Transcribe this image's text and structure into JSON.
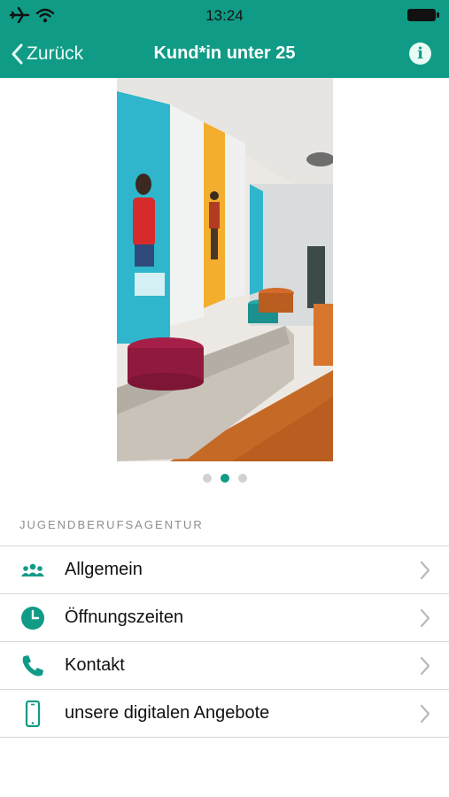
{
  "status_bar": {
    "time": "13:24"
  },
  "nav": {
    "back_label": "Zurück",
    "title": "Kund*in unter 25",
    "info_label": "i"
  },
  "carousel": {
    "page_count": 3,
    "active_index": 1
  },
  "section": {
    "header": "JUGENDBERUFSAGENTUR"
  },
  "menu": [
    {
      "label": "Allgemein",
      "icon": "people-icon"
    },
    {
      "label": "Öffnungszeiten",
      "icon": "clock-icon"
    },
    {
      "label": "Kontakt",
      "icon": "phone-icon"
    },
    {
      "label": "unsere digitalen Angebote",
      "icon": "smartphone-icon"
    }
  ],
  "colors": {
    "accent": "#109b86",
    "separator": "#d6d6d6",
    "section_text": "#8e8e8e"
  }
}
